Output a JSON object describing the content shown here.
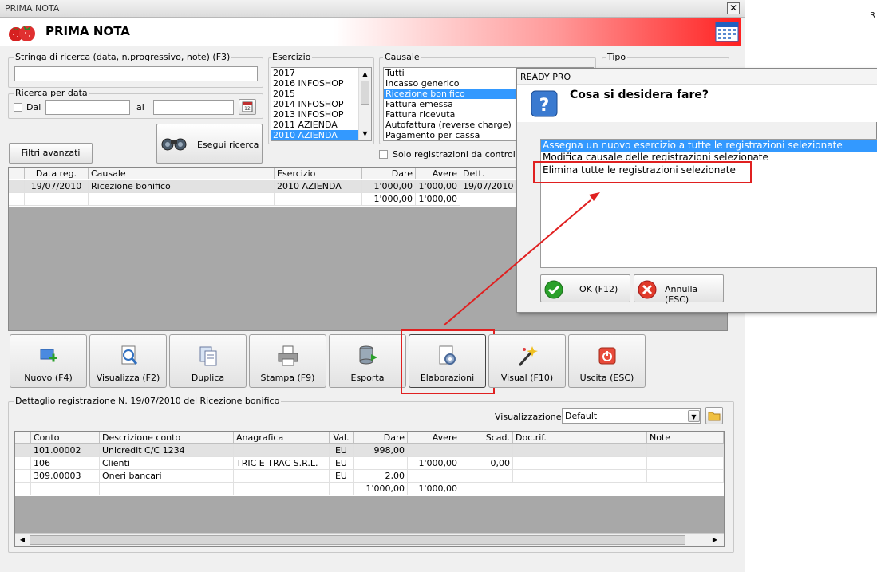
{
  "window": {
    "title": "PRIMA NOTA",
    "close": "✕",
    "header_title": "PRIMA NOTA",
    "right_edge_text": "R"
  },
  "search": {
    "label": "Stringa di ricerca (data, n.progressivo, note) (F3)",
    "value": ""
  },
  "date_search": {
    "label": "Ricerca per data",
    "dal_label": "Dal",
    "al_label": "al",
    "dal_value": "",
    "al_value": ""
  },
  "buttons": {
    "filtri": "Filtri avanzati",
    "esegui": "Esegui ricerca"
  },
  "esercizio": {
    "label": "Esercizio",
    "items": [
      "2017",
      "2016 INFOSHOP",
      "2015",
      "2014 INFOSHOP",
      "2013 INFOSHOP",
      "2011 AZIENDA",
      "2010 AZIENDA"
    ],
    "selected": "2010 AZIENDA"
  },
  "causale": {
    "label": "Causale",
    "items": [
      "Tutti",
      "Incasso generico",
      "Ricezione bonifico",
      "Fattura emessa",
      "Fattura ricevuta",
      "Autofattura (reverse charge)",
      "Pagamento per cassa"
    ],
    "selected": "Ricezione bonifico",
    "solo_label": "Solo registrazioni da controllare"
  },
  "tipo": {
    "label": "Tipo"
  },
  "main_grid": {
    "headers": [
      "Data reg.",
      "Causale",
      "Esercizio",
      "Dare",
      "Avere",
      "Dett."
    ],
    "rows": [
      [
        "19/07/2010",
        "Ricezione bonifico",
        "2010 AZIENDA",
        "1'000,00",
        "1'000,00",
        "19/07/2010"
      ]
    ],
    "totals": {
      "dare": "1'000,00",
      "avere": "1'000,00"
    }
  },
  "toolbar": [
    "Nuovo (F4)",
    "Visualizza (F2)",
    "Duplica",
    "Stampa (F9)",
    "Esporta",
    "Elaborazioni",
    "Visual (F10)",
    "Uscita (ESC)"
  ],
  "detail": {
    "label": "Dettaglio registrazione N. 19/07/2010 del Ricezione bonifico",
    "view_label": "Visualizzazione :",
    "view_value": "Default",
    "headers": [
      "Conto",
      "Descrizione conto",
      "Anagrafica",
      "Val.",
      "Dare",
      "Avere",
      "Scad.",
      "Doc.rif.",
      "Note"
    ],
    "rows": [
      [
        "101.00002",
        "Unicredit C/C 1234",
        "",
        "EU",
        "998,00",
        "",
        "",
        "",
        ""
      ],
      [
        "106",
        "Clienti",
        "TRIC E TRAC S.R.L.",
        "EU",
        "",
        "1'000,00",
        "0,00",
        "",
        ""
      ],
      [
        "309.00003",
        "Oneri bancari",
        "",
        "EU",
        "2,00",
        "",
        "",
        "",
        ""
      ]
    ],
    "totals": {
      "dare": "1'000,00",
      "avere": "1'000,00"
    }
  },
  "dialog": {
    "title": "READY PRO",
    "question": "Cosa si desidera fare?",
    "options": [
      "Assegna un nuovo esercizio a tutte le registrazioni selezionate",
      "Modifica causale delle registrazioni selezionate",
      "Elimina tutte le registrazioni selezionate"
    ],
    "selected_index": 0,
    "ok": "OK (F12)",
    "cancel": "Annulla (ESC)"
  },
  "colors": {
    "selection": "#3399ff",
    "highlight": "#e02020",
    "header_red": "#ff2020"
  }
}
